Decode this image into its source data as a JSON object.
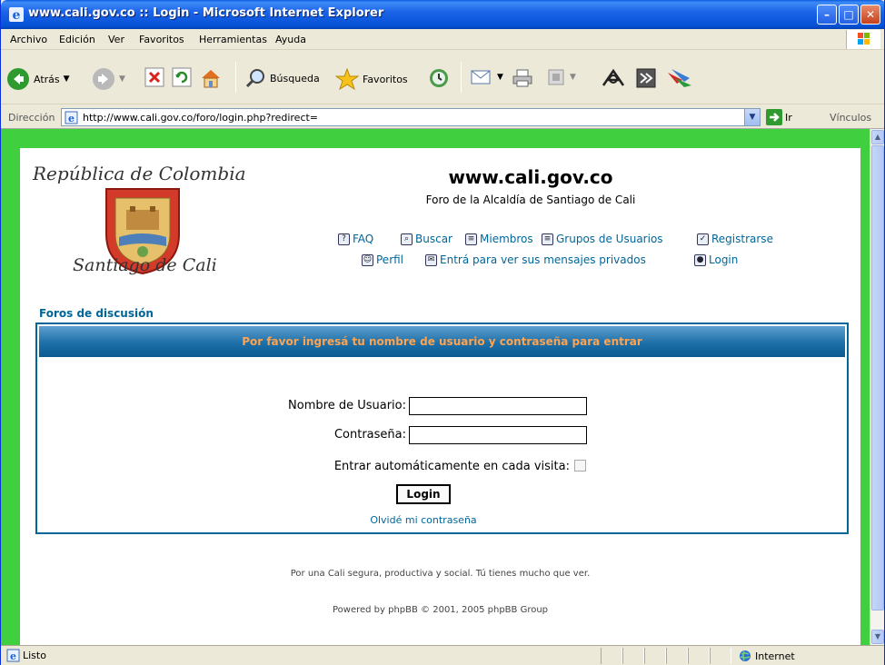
{
  "window": {
    "title": "www.cali.gov.co :: Login - Microsoft Internet Explorer",
    "min_label": "–",
    "max_label": "□",
    "close_label": "✕"
  },
  "menu": [
    "Archivo",
    "Edición",
    "Ver",
    "Favoritos",
    "Herramientas",
    "Ayuda"
  ],
  "toolbar": {
    "back_label": "Atrás",
    "search_label": "Búsqueda",
    "favorites_label": "Favoritos"
  },
  "address": {
    "label": "Dirección",
    "url": "http://www.cali.gov.co/foro/login.php?redirect=",
    "go_label": "Ir",
    "links_label": "Vínculos"
  },
  "logo": {
    "top_text": "República de Colombia",
    "bottom_text": "Santiago de Cali"
  },
  "site": {
    "title": "www.cali.gov.co",
    "description": "Foro de la Alcaldía de Santiago de Cali"
  },
  "nav": {
    "faq": "FAQ",
    "search": "Buscar",
    "members": "Miembros",
    "groups": "Grupos de Usuarios",
    "register": "Registrarse",
    "profile": "Perfil",
    "messages": "Entrá para ver sus mensajes privados",
    "login": "Login"
  },
  "forums_link": "Foros de discusión",
  "login_form": {
    "header": "Por favor ingresá tu nombre de usuario y contraseña para entrar",
    "username_label": "Nombre de Usuario:",
    "username_value": "",
    "password_label": "Contraseña:",
    "password_value": "",
    "autologin_label": "Entrar automáticamente en cada visita:",
    "autologin_checked": false,
    "submit_label": "Login",
    "forgot_label": "Olvidé mi contraseña"
  },
  "footer": {
    "slogan": "Por una Cali segura, productiva y social. Tú tienes mucho que ver.",
    "powered": "Powered by phpBB © 2001, 2005 phpBB Group"
  },
  "status": {
    "text": "Listo",
    "zone": "Internet"
  },
  "colors": {
    "page_bg": "#3fcf3f",
    "link": "#006699",
    "header_text": "#ffa34f"
  },
  "icons": [
    "ie-icon",
    "back-icon",
    "forward-icon",
    "stop-icon",
    "refresh-icon",
    "home-icon",
    "search-icon",
    "favorites-icon",
    "history-icon",
    "mail-icon",
    "print-icon",
    "edit-icon",
    "messenger-icon",
    "research-icon",
    "page-icon",
    "go-icon",
    "internet-zone-icon"
  ]
}
